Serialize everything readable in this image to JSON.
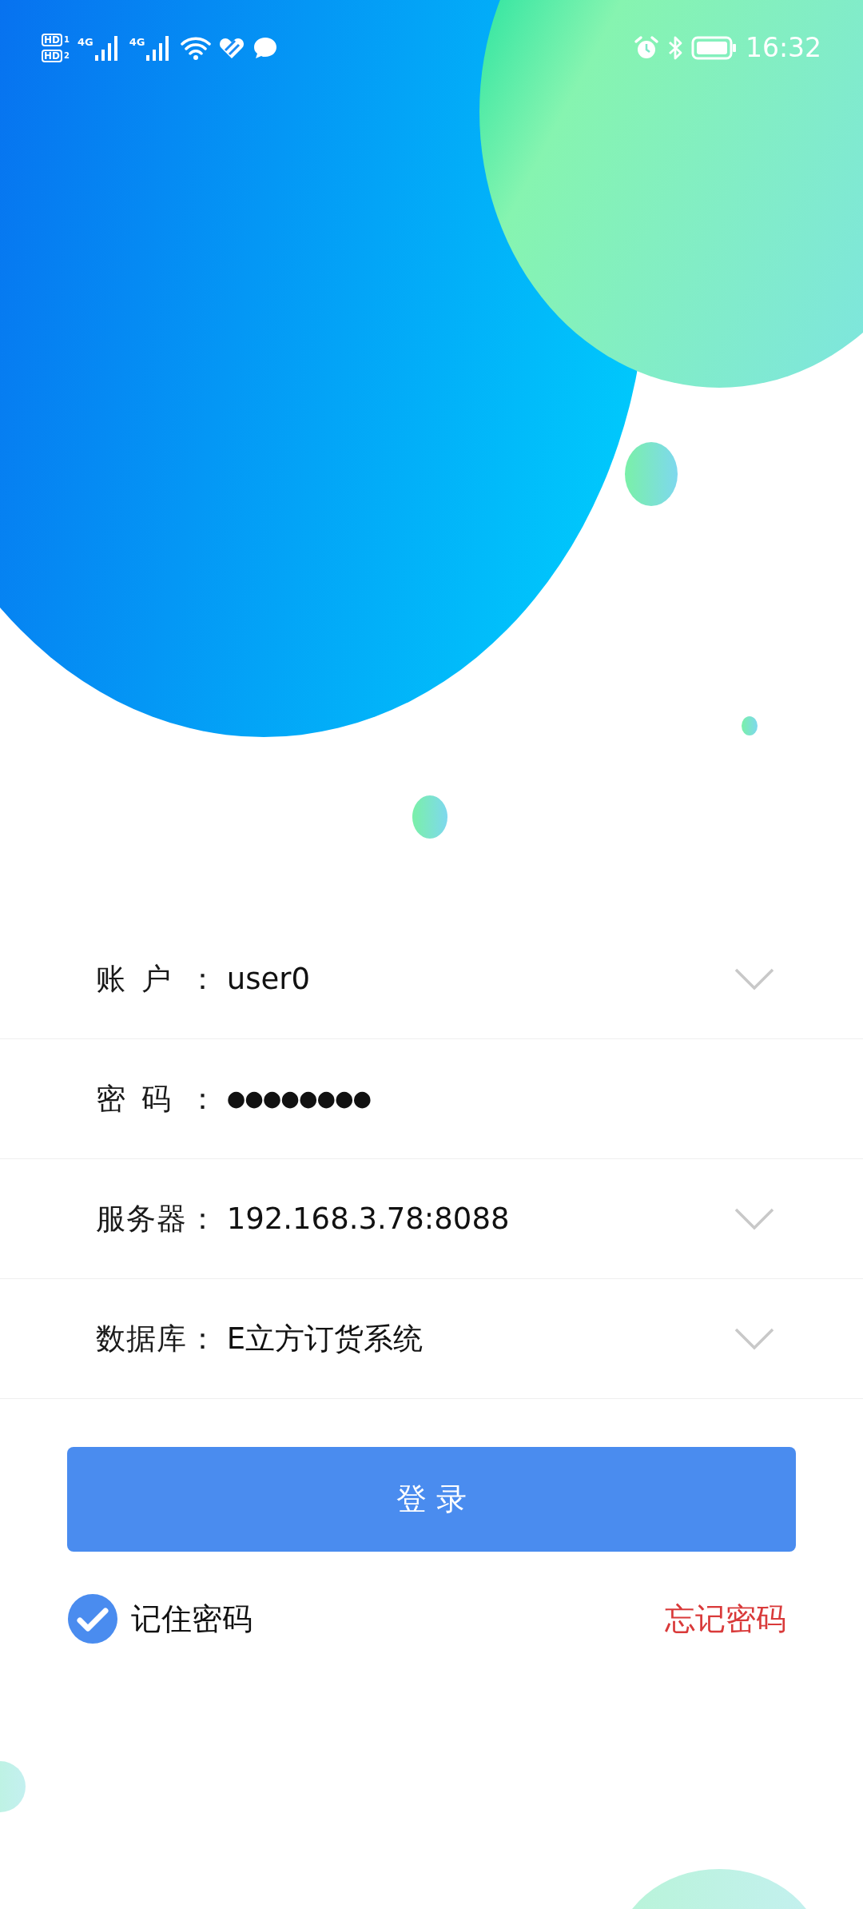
{
  "status_bar": {
    "sims": [
      {
        "text": "HD",
        "slot": "1"
      },
      {
        "text": "HD",
        "slot": "2"
      }
    ],
    "networks": [
      {
        "label": "4G"
      },
      {
        "label": "4G"
      }
    ],
    "time": "16:32"
  },
  "form": {
    "fields": [
      {
        "label": "账户：",
        "value": "user0",
        "kind": "dropdown"
      },
      {
        "label": "密码：",
        "value": "●●●●●●●●",
        "kind": "password"
      },
      {
        "label": "服务器：",
        "value": "192.168.3.78:8088",
        "kind": "dropdown"
      },
      {
        "label": "数据库：",
        "value": "E立方订货系统",
        "kind": "dropdown"
      }
    ]
  },
  "login_button": "登 录",
  "remember": {
    "label": "记住密码",
    "checked": true
  },
  "forgot_link": "忘记密码"
}
